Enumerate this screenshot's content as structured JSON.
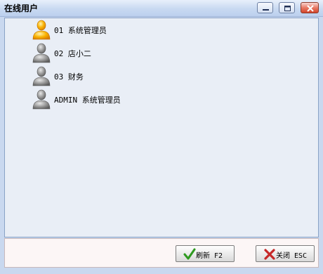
{
  "window": {
    "title": "在线用户"
  },
  "users": [
    {
      "label": "01 系统管理员",
      "status": "online",
      "icon": "user-online-icon"
    },
    {
      "label": "02 店小二",
      "status": "offline",
      "icon": "user-offline-icon"
    },
    {
      "label": "03 财务",
      "status": "offline",
      "icon": "user-offline-icon"
    },
    {
      "label": "ADMIN 系统管理员",
      "status": "offline",
      "icon": "user-offline-icon"
    }
  ],
  "buttons": {
    "refresh_label": "刷新 F2",
    "close_label": "关闭 ESC"
  },
  "colors": {
    "online": "#f5a100",
    "offline": "#8a8a8a",
    "confirm_check": "#2e9a1f",
    "close_x": "#c62828"
  }
}
